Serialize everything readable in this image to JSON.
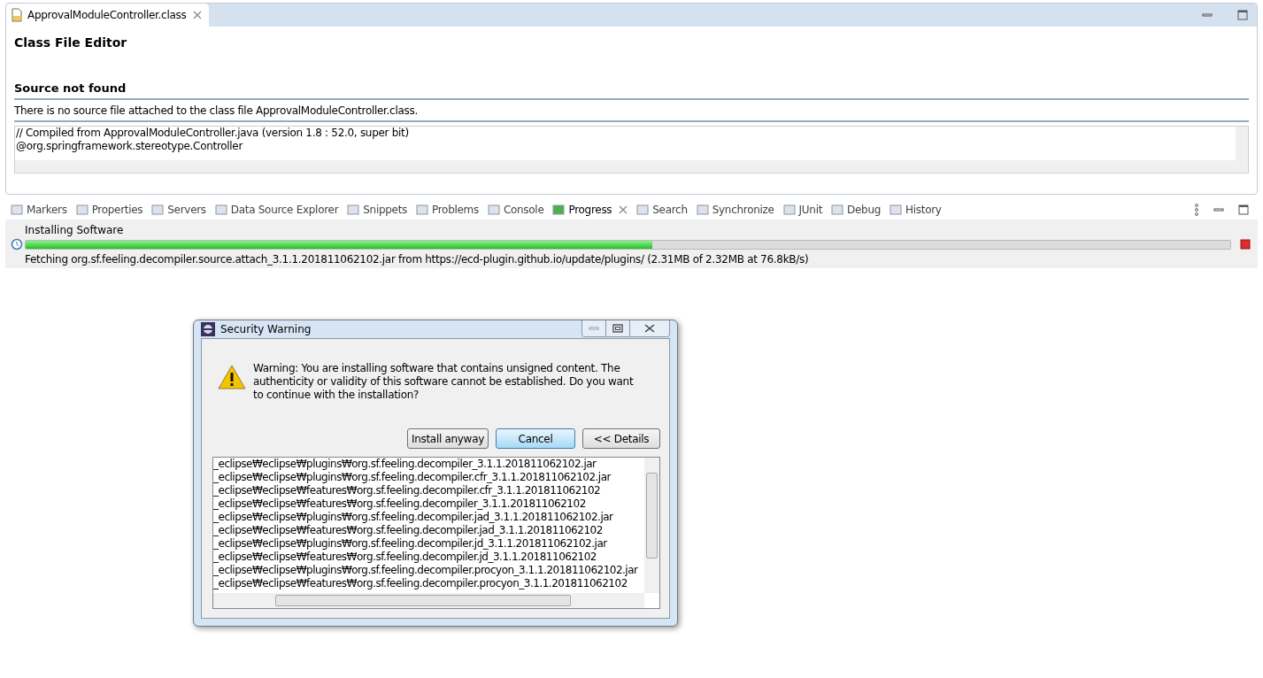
{
  "editor": {
    "tab": {
      "label": "ApprovalModuleController.class",
      "selected": true
    },
    "heading": "Class File Editor",
    "section_title": "Source not found",
    "message": "There is no source file attached to the class file ApprovalModuleController.class.",
    "code_lines": [
      "// Compiled from ApprovalModuleController.java (version 1.8 : 52.0, super bit)",
      "@org.springframework.stereotype.Controller"
    ]
  },
  "views": {
    "tabs": [
      {
        "label": "Markers",
        "selected": false
      },
      {
        "label": "Properties",
        "selected": false
      },
      {
        "label": "Servers",
        "selected": false
      },
      {
        "label": "Data Source Explorer",
        "selected": false
      },
      {
        "label": "Snippets",
        "selected": false
      },
      {
        "label": "Problems",
        "selected": false
      },
      {
        "label": "Console",
        "selected": false
      },
      {
        "label": "Progress",
        "selected": true
      },
      {
        "label": "Search",
        "selected": false
      },
      {
        "label": "Synchronize",
        "selected": false
      },
      {
        "label": "JUnit",
        "selected": false
      },
      {
        "label": "Debug",
        "selected": false
      },
      {
        "label": "History",
        "selected": false
      }
    ],
    "progress": {
      "title": "Installing Software",
      "level": 0.52,
      "detail": "Fetching org.sf.feeling.decompiler.source.attach_3.1.1.201811062102.jar from https://ecd-plugin.github.io/update/plugins/ (2.31MB of 2.32MB at 76.8kB/s)"
    }
  },
  "dialog": {
    "title": "Security Warning",
    "message": "Warning: You are installing software that contains unsigned content. The authenticity or validity of this software cannot be established. Do you want to continue with the installation?",
    "buttons": [
      {
        "label": "Install anyway",
        "default": false
      },
      {
        "label": "Cancel",
        "default": true
      },
      {
        "label": "<< Details",
        "default": false
      }
    ],
    "files": [
      "_eclipse₩eclipse₩plugins₩org.sf.feeling.decompiler_3.1.1.201811062102.jar",
      "_eclipse₩eclipse₩plugins₩org.sf.feeling.decompiler.cfr_3.1.1.201811062102.jar",
      "_eclipse₩eclipse₩features₩org.sf.feeling.decompiler.cfr_3.1.1.201811062102",
      "_eclipse₩eclipse₩features₩org.sf.feeling.decompiler_3.1.1.201811062102",
      "_eclipse₩eclipse₩plugins₩org.sf.feeling.decompiler.jad_3.1.1.201811062102.jar",
      "_eclipse₩eclipse₩features₩org.sf.feeling.decompiler.jad_3.1.1.201811062102",
      "_eclipse₩eclipse₩plugins₩org.sf.feeling.decompiler.jd_3.1.1.201811062102.jar",
      "_eclipse₩eclipse₩features₩org.sf.feeling.decompiler.jd_3.1.1.201811062102",
      "_eclipse₩eclipse₩plugins₩org.sf.feeling.decompiler.procyon_3.1.1.201811062102.jar",
      "_eclipse₩eclipse₩features₩org.sf.feeling.decompiler.procyon_3.1.1.201811062102"
    ]
  }
}
